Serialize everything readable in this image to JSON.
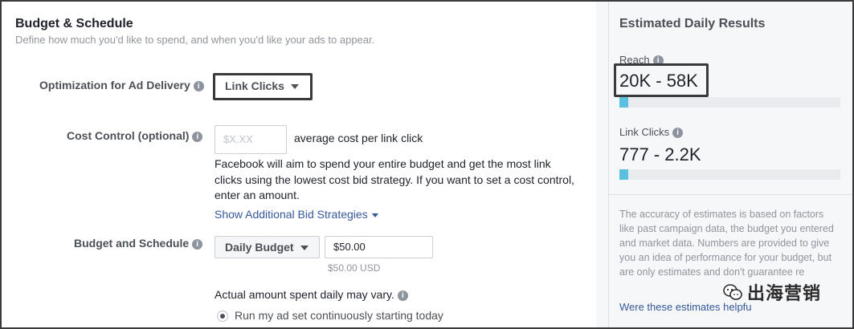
{
  "budget_section": {
    "title": "Budget & Schedule",
    "subtitle": "Define how much you'd like to spend, and when you'd like your ads to appear."
  },
  "optimization": {
    "label": "Optimization for Ad Delivery",
    "selected": "Link Clicks"
  },
  "cost_control": {
    "label": "Cost Control (optional)",
    "placeholder": "$X.XX",
    "suffix": "average cost per link click",
    "description": "Facebook will aim to spend your entire budget and get the most link clicks using the lowest cost bid strategy. If you want to set a cost control, enter an amount.",
    "more_link": "Show Additional Bid Strategies"
  },
  "budget_schedule": {
    "label": "Budget and Schedule",
    "budget_type": "Daily Budget",
    "amount": "$50.00",
    "amount_note": "$50.00 USD",
    "vary_note": "Actual amount spent daily may vary.",
    "schedule_option": "Run my ad set continuously starting today"
  },
  "estimates": {
    "title": "Estimated Daily Results",
    "reach": {
      "label": "Reach",
      "value": "20K - 58K",
      "level_percent": 4
    },
    "link_clicks": {
      "label": "Link Clicks",
      "value": "777 - 2.2K",
      "level_percent": 4
    },
    "disclaimer": "The accuracy of estimates is based on factors like past campaign data, the budget you entered and market data. Numbers are provided to give you an idea of performance for your budget, but are only estimates and don't guarantee re",
    "feedback_link": "Were these estimates helpfu"
  },
  "watermark": {
    "text": "出海营销",
    "icon": "wechat-icon"
  },
  "colors": {
    "bar": "#5bc0de",
    "link": "#365899",
    "panel": "#f6f7f9"
  }
}
